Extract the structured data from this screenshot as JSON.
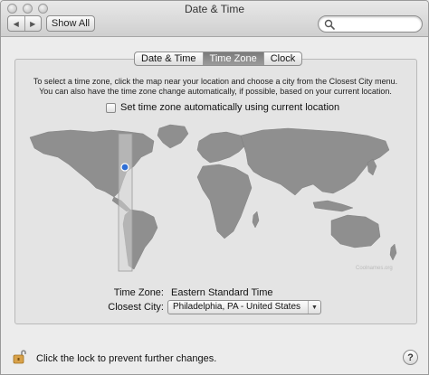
{
  "window": {
    "title": "Date & Time"
  },
  "toolbar": {
    "back_glyph": "◀",
    "forward_glyph": "▶",
    "show_all_label": "Show All",
    "search_value": "",
    "search_icon": "search-icon"
  },
  "tabs": [
    {
      "label": "Date & Time",
      "active": false
    },
    {
      "label": "Time Zone",
      "active": true
    },
    {
      "label": "Clock",
      "active": false
    }
  ],
  "instructions": {
    "line1": "To select a time zone, click the map near your location and choose a city from the Closest City menu.",
    "line2": "You can also have the time zone change automatically, if possible, based on your current location."
  },
  "auto_timezone": {
    "label": "Set time zone automatically using current location",
    "checked": false
  },
  "map": {
    "watermark": "Coolnames.org",
    "land_color": "#8f8f8f",
    "highlight_color": "#d5d5d5",
    "pin_color": "#2f6fd6"
  },
  "time_zone": {
    "label": "Time Zone:",
    "value": "Eastern Standard Time"
  },
  "closest_city": {
    "label": "Closest City:",
    "value": "Philadelphia, PA - United States"
  },
  "footer": {
    "lock_text": "Click the lock to prevent further changes.",
    "lock_icon": "open-lock-icon",
    "help_glyph": "?"
  }
}
